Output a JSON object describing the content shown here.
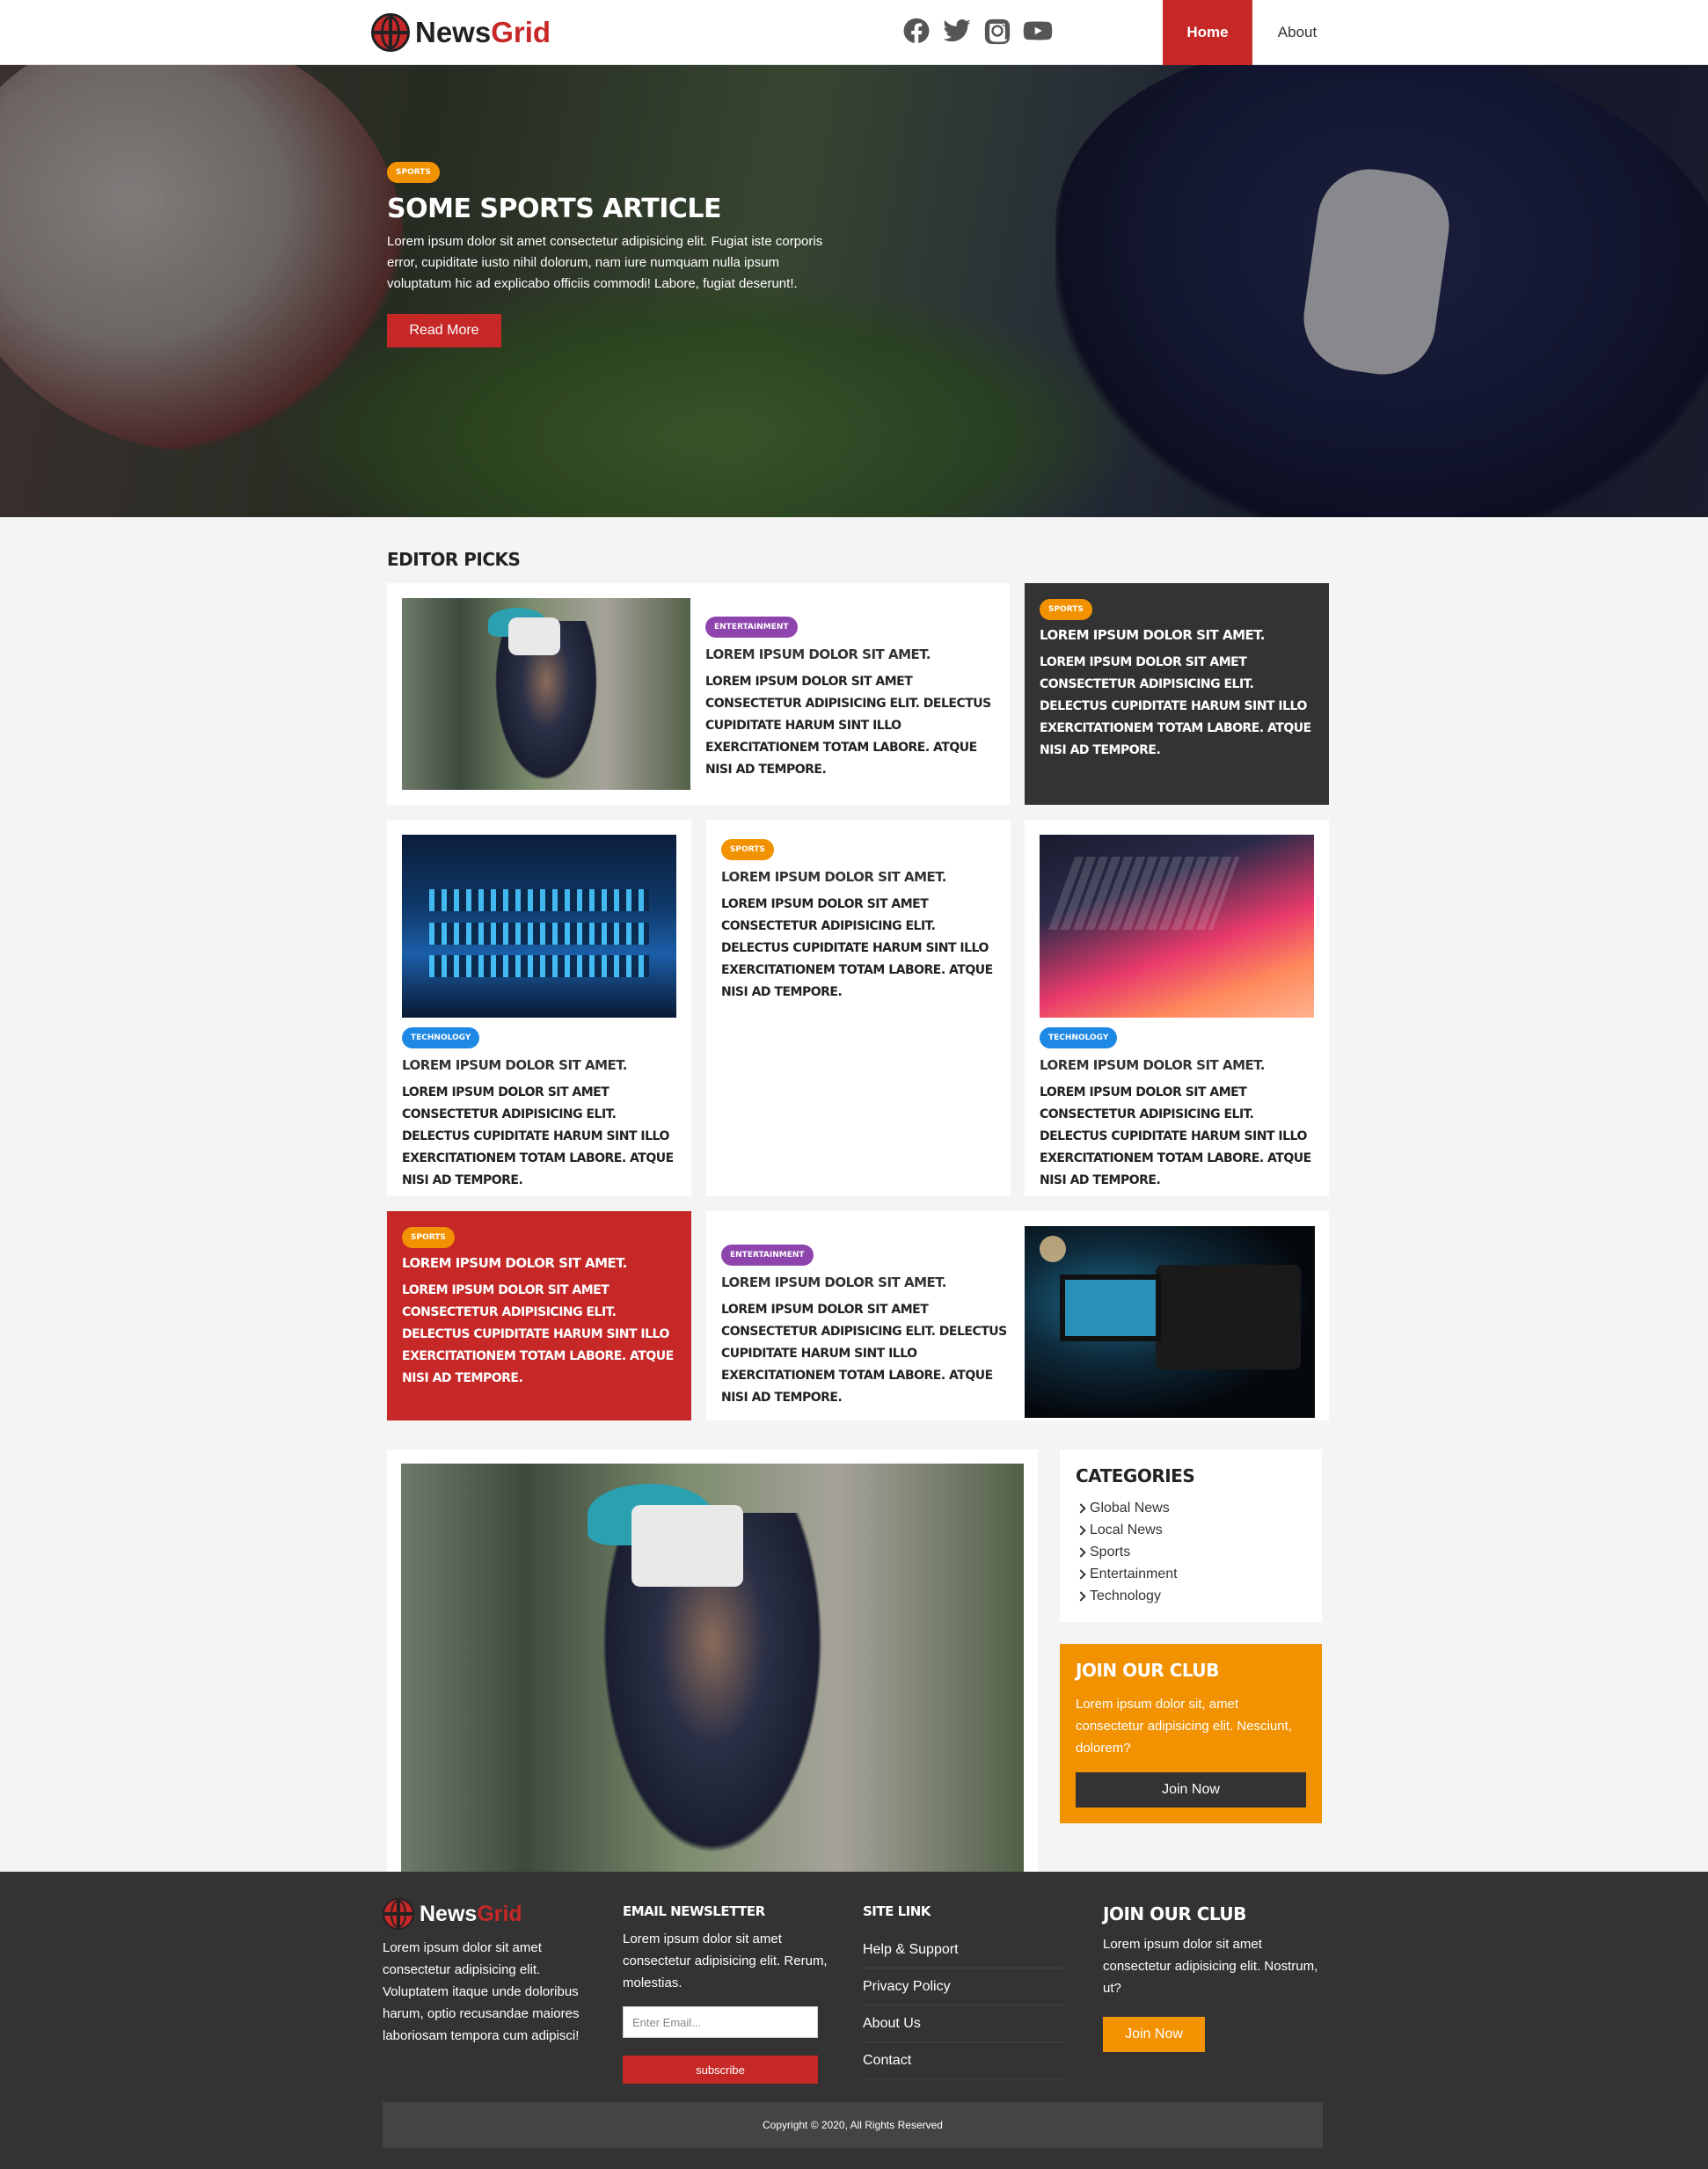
{
  "nav": {
    "logo_main": "News",
    "logo_accent": "Grid",
    "social": [
      "facebook-icon",
      "twitter-icon",
      "instagram-icon",
      "youtube-icon"
    ],
    "home": "Home",
    "about": "About"
  },
  "hero": {
    "category": "Sports",
    "title": "Some Sports Article",
    "text": "Lorem ipsum dolor sit amet consectetur adipisicing elit. Fugiat iste corporis error, cupiditate iusto nihil dolorum, nam iure numquam nulla ipsum voluptatum hic ad explicabo officiis commodi! Labore, fugiat deserunt!.",
    "button": "Read More"
  },
  "editor": {
    "title": "Editor Picks",
    "card_title": "Lorem ipsum dolor sit amet.",
    "card_body": "Lorem ipsum dolor sit amet consectetur adipisicing elit. Delectus cupiditate harum sint illo exercitationem totam labore. Atque nisi ad tempore.",
    "cards": [
      {
        "category": "Entertainment"
      },
      {
        "category": "Sports"
      },
      {
        "category": "Technology"
      },
      {
        "category": "Sports"
      },
      {
        "category": "Technology"
      },
      {
        "category": "Sports"
      },
      {
        "category": "Entertainment"
      }
    ]
  },
  "sidebar": {
    "categories_title": "Categories",
    "categories": [
      "Global News",
      "Local News",
      "Sports",
      "Entertainment",
      "Technology"
    ],
    "club_title": "Join Our Club",
    "club_text": "Lorem ipsum dolor sit, amet consectetur adipisicing elit. Nesciunt, dolorem?",
    "club_button": "Join Now"
  },
  "footer": {
    "logo_main": "News",
    "logo_accent": "Grid",
    "about_text": "Lorem ipsum dolor sit amet consectetur adipisicing elit. Voluptatem itaque unde doloribus harum, optio recusandae maiores laboriosam tempora cum adipisci!",
    "newsletter_title": "Email Newsletter",
    "newsletter_text": "Lorem ipsum dolor sit amet consectetur adipisicing elit. Rerum, molestias.",
    "email_placeholder": "Enter Email...",
    "subscribe": "subscribe",
    "sitelink_title": "Site Link",
    "links": [
      "Help & Support",
      "Privacy Policy",
      "About Us",
      "Contact"
    ],
    "club_title": "Join Our Club",
    "club_text": "Lorem ipsum dolor sit amet consectetur adipisicing elit. Nostrum, ut?",
    "club_button": "Join Now",
    "copyright": "Copyright © 2020, All Rights Reserved"
  },
  "colors": {
    "primary": "#c62828",
    "sports": "#f39200",
    "entertainment": "#8e44ad",
    "technology": "#1e88e5",
    "dark": "#333333"
  }
}
